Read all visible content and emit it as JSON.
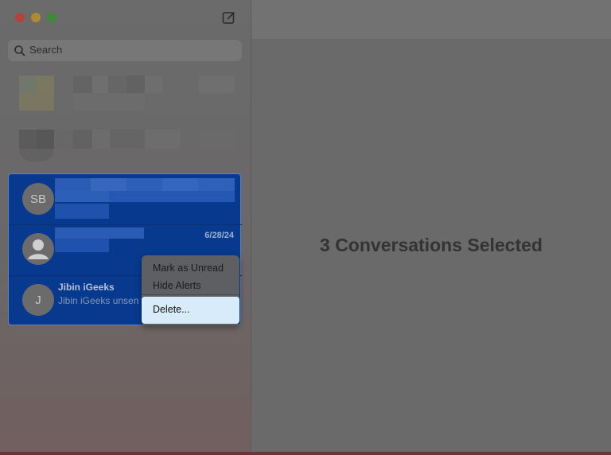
{
  "search": {
    "placeholder": "Search"
  },
  "conversations": [
    {
      "avatar": "SB"
    },
    {
      "avatar": "",
      "date": "6/28/24"
    },
    {
      "avatar": "J",
      "name": "Jibin iGeeks",
      "preview": "Jibin iGeeks unsen"
    }
  ],
  "context_menu": {
    "items": [
      "Mark as Unread",
      "Hide Alerts",
      "Delete..."
    ]
  },
  "main": {
    "status": "3 Conversations Selected"
  },
  "icons": {
    "compose": "compose-icon",
    "search": "search-icon",
    "person": "person-icon"
  },
  "colors": {
    "selection": "#073a8e",
    "highlight": "#d8ebf8",
    "close": "#b5413b",
    "minimize": "#b08a2e",
    "zoom": "#3f8a3a"
  }
}
